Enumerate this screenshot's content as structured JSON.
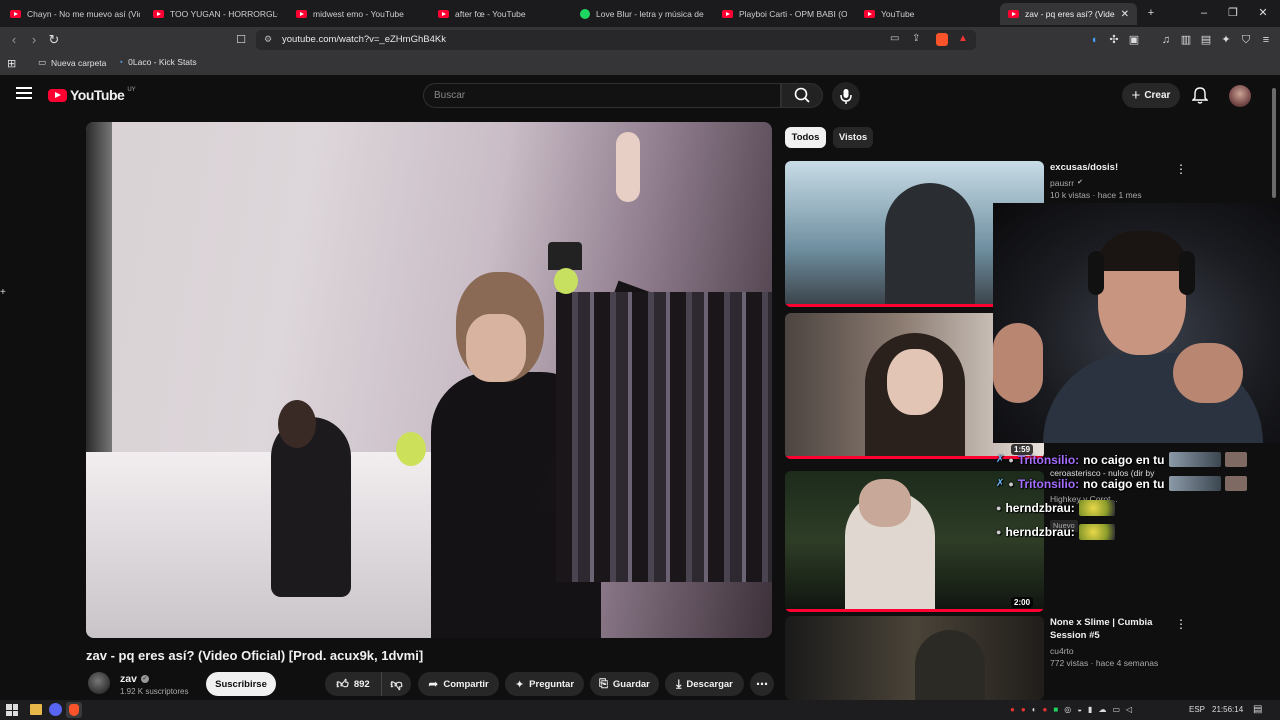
{
  "browser": {
    "tabs": [
      {
        "label": "Chayn - No me muevo así (Vid",
        "icon": "youtube-icon"
      },
      {
        "label": "TOO YUGAN - HORRORGLO M",
        "icon": "youtube-icon"
      },
      {
        "label": "midwest emo - YouTube",
        "icon": "youtube-icon"
      },
      {
        "label": "after fœ - YouTube",
        "icon": "youtube-icon"
      },
      {
        "label": "Love Blur - letra y música de sl",
        "icon": "spotify-icon"
      },
      {
        "label": "Playboi Carti - OPM BABI (Offi",
        "icon": "youtube-icon"
      },
      {
        "label": "YouTube",
        "icon": "youtube-icon"
      },
      {
        "label": "zav - pq eres así? (Video C",
        "icon": "youtube-icon"
      }
    ],
    "url": "youtube.com/watch?v=_eZHmGhB4Kk",
    "bookmarks": [
      "Nueva carpeta",
      "0Laco - Kick Stats"
    ]
  },
  "youtube": {
    "logo_text": "YouTube",
    "country_code": "UY",
    "search_placeholder": "Buscar",
    "create_label": "Crear"
  },
  "video": {
    "title": "zav - pq eres así? (Video Oficial) [Prod. acux9k, 1dvmi]",
    "channel": "zav",
    "subscribers": "1.92 K suscriptores",
    "subscribe_label": "Suscribirse",
    "likes": "892",
    "share_label": "Compartir",
    "ask_label": "Preguntar",
    "save_label": "Guardar",
    "download_label": "Descargar"
  },
  "sidebar": {
    "chips": [
      "Todos",
      "Vistos"
    ],
    "items": [
      {
        "title": "excusas/dosis!",
        "channel": "pausrr",
        "meta": "10 k vistas · hace 1 mes"
      },
      {
        "title": "",
        "channel": "",
        "meta": "",
        "duration": "1:59"
      },
      {
        "title": "",
        "channel": "ceroasterisco - nulos (dir by",
        "meta": "Highkey y Corot...",
        "duration": "2:00",
        "badge": "Nuevo"
      },
      {
        "title": "None x Slime | Cumbia Session #5",
        "channel": "cu4rto",
        "meta": "772 vistas · hace 4 semanas"
      }
    ]
  },
  "chat_overlay": [
    {
      "user": "Tritonsilio:",
      "text": "no caigo en tu",
      "color": "#a46cff"
    },
    {
      "user": "Tritonsilio:",
      "text": "no caigo en tu",
      "color": "#a46cff"
    },
    {
      "user": "herndzbrau:",
      "text": "",
      "color": "#ffffff"
    },
    {
      "user": "herndzbrau:",
      "text": "",
      "color": "#ffffff"
    }
  ],
  "taskbar": {
    "language": "ESP",
    "time": "21:56:14"
  }
}
